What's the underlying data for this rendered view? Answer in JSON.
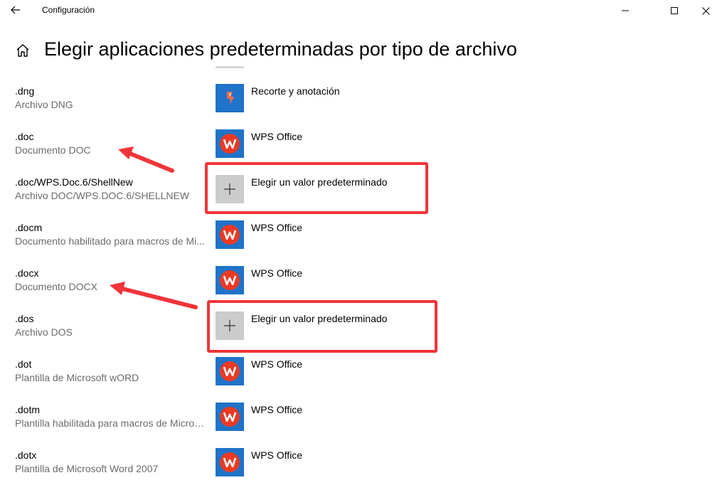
{
  "window": {
    "title": "Configuración",
    "buttons": [
      "minimize",
      "maximize",
      "close"
    ]
  },
  "header": {
    "title": "Elegir aplicaciones predeterminadas por tipo de archivo"
  },
  "rows": [
    {
      "ext": ".dng",
      "desc": "Archivo DNG",
      "app": "Recorte y anotación",
      "icon": "snip-sketch-icon"
    },
    {
      "ext": ".doc",
      "desc": "Documento DOC",
      "app": "WPS Office",
      "icon": "wps-office-icon"
    },
    {
      "ext": ".doc/WPS.Doc.6/ShellNew",
      "desc": "Archivo DOC/WPS.DOC.6/SHELLNEW",
      "app": "Elegir un valor predeterminado",
      "icon": "plus-icon"
    },
    {
      "ext": ".docm",
      "desc": "Documento habilitado para macros de Mi...",
      "app": "WPS Office",
      "icon": "wps-office-icon"
    },
    {
      "ext": ".docx",
      "desc": "Documento DOCX",
      "app": "WPS Office",
      "icon": "wps-office-icon"
    },
    {
      "ext": ".dos",
      "desc": "Archivo DOS",
      "app": "Elegir un valor predeterminado",
      "icon": "plus-icon"
    },
    {
      "ext": ".dot",
      "desc": "Plantilla de Microsoft wORD",
      "app": "WPS Office",
      "icon": "wps-office-icon"
    },
    {
      "ext": ".dotm",
      "desc": "Plantilla habilitada para macros de Micros...",
      "app": "WPS Office",
      "icon": "wps-office-icon"
    },
    {
      "ext": ".dotx",
      "desc": "Plantilla de Microsoft Word 2007",
      "app": "WPS Office",
      "icon": "wps-office-icon"
    }
  ],
  "colors": {
    "accent": "#1f73c8",
    "wps": "#ea3a24",
    "annotation": "#f0343a",
    "secondary_text": "#6b6b6b"
  }
}
